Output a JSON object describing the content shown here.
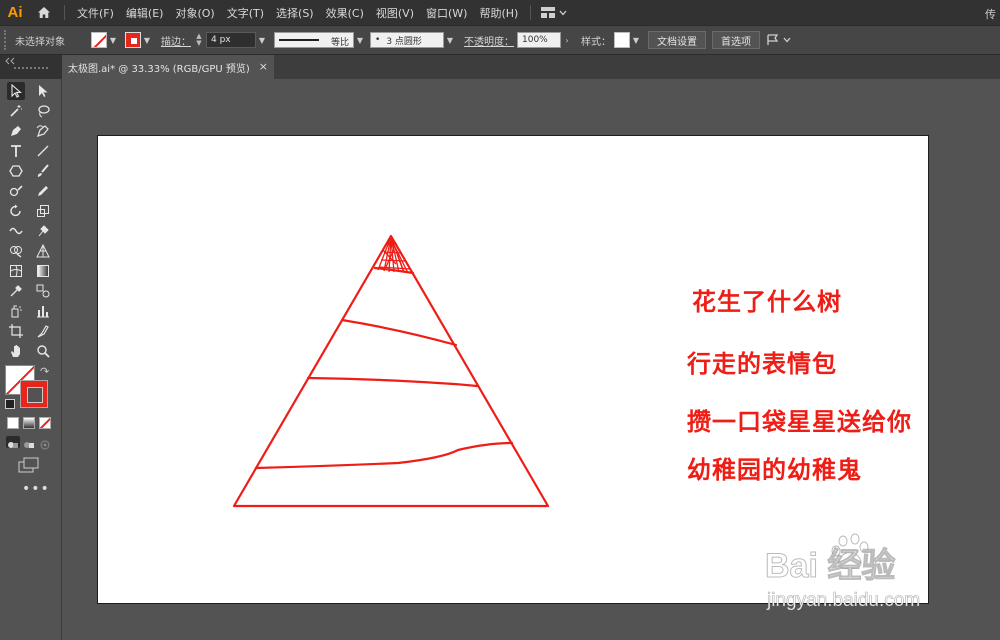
{
  "app": {
    "logo": "Ai",
    "right_label": "传"
  },
  "menu": [
    "文件(F)",
    "编辑(E)",
    "对象(O)",
    "文字(T)",
    "选择(S)",
    "效果(C)",
    "视图(V)",
    "窗口(W)",
    "帮助(H)"
  ],
  "control_bar": {
    "selection": "未选择对象",
    "stroke_label": "描边：",
    "stroke_value": "4 px",
    "profile_label": "等比",
    "brush_label": "3 点圆形",
    "opacity_label": "不透明度：",
    "opacity_value": "100%",
    "style_label": "样式：",
    "doc_setup": "文档设置",
    "preferences": "首选项"
  },
  "document_tab": {
    "title": "太极图.ai* @ 33.33% (RGB/GPU 预览)",
    "close": "×"
  },
  "artboard": {
    "accent_color": "#ee1d16",
    "texts": [
      "花生了什么树",
      "行走的表情包",
      "攒一口袋星星送给你",
      "幼稚园的幼稚鬼"
    ]
  },
  "watermark": {
    "brand": "Bai 经验",
    "url": "jingyan.baidu.com"
  }
}
